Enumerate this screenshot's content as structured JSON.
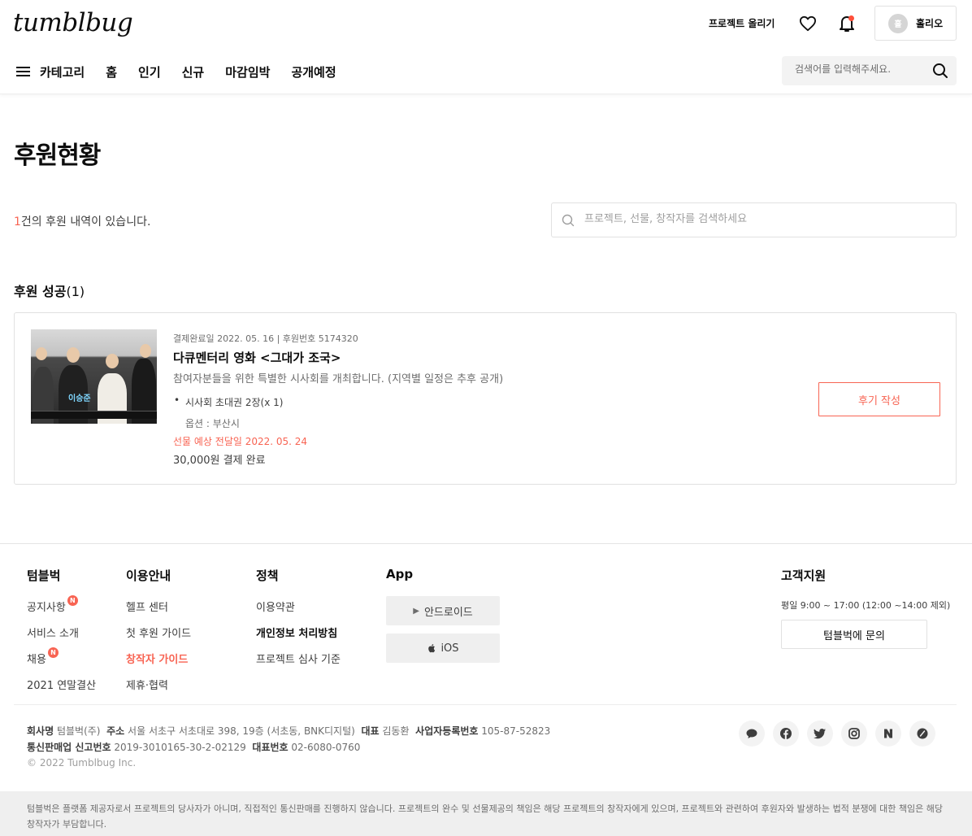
{
  "header": {
    "logo": "tumblbug",
    "upload_label": "프로젝트 올리기",
    "profile_avatar": "홀",
    "profile_name": "홀리오",
    "nav": {
      "category": "카테고리",
      "items": [
        "홈",
        "인기",
        "신규",
        "마감임박",
        "공개예정"
      ]
    },
    "search_placeholder": "검색어를 입력해주세요."
  },
  "main": {
    "title": "후원현황",
    "count_number": "1",
    "count_suffix": "건의 후원 내역이 있습니다.",
    "search_placeholder": "프로젝트, 선물, 창작자를 검색하세요",
    "section_title": "후원 성공",
    "section_count": "(1)",
    "pledge": {
      "thumb_name": "이승준",
      "meta": "결제완료일 2022. 05. 16 | 후원번호 5174320",
      "title": "다큐멘터리 영화 <그대가 조국>",
      "description": "참여자분들을 위한 특별한 시사회를 개최합니다. (지역별 일정은 추후 공개)",
      "reward": "시사회 초대권 2장(x 1)",
      "option": "옵션 : 부산시",
      "delivery": "선물 예상 전달일 2022. 05. 24",
      "payment": "30,000원 결제 완료",
      "review_button": "후기 작성"
    }
  },
  "footer": {
    "col1": {
      "title": "텀블벅",
      "links": [
        "공지사항",
        "서비스 소개",
        "채용",
        "2021 연말결산"
      ],
      "badge": "N"
    },
    "col2": {
      "title": "이용안내",
      "links": [
        "헬프 센터",
        "첫 후원 가이드",
        "창작자 가이드",
        "제휴·협력"
      ]
    },
    "col3": {
      "title": "정책",
      "links": [
        "이용약관",
        "개인정보 처리방침",
        "프로젝트 심사 기준"
      ]
    },
    "app": {
      "title": "App",
      "android": "안드로이드",
      "ios": "iOS"
    },
    "support": {
      "title": "고객지원",
      "hours": "평일 9:00 ~ 17:00 (12:00 ~14:00 제외)",
      "button": "텀블벅에 문의"
    },
    "company": {
      "name_label": "회사명",
      "name": "텀블벅(주)",
      "address_label": "주소",
      "address": "서울 서초구 서초대로 398, 19층 (서초동, BNK디지털)",
      "ceo_label": "대표",
      "ceo": "김동환",
      "biz_label": "사업자등록번호",
      "biz": "105-87-52823",
      "mail_order_label": "통신판매업 신고번호",
      "mail_order": "2019-3010165-30-2-02129",
      "phone_label": "대표번호",
      "phone": "02-6080-0760"
    },
    "copyright": "© 2022 Tumblbug Inc.",
    "social_icons": [
      "chat-icon",
      "facebook-icon",
      "twitter-icon",
      "instagram-icon",
      "naver-icon",
      "blog-icon"
    ],
    "disclaimer": "텀블벅은 플랫폼 제공자로서 프로젝트의 당사자가 아니며, 직접적인 통신판매를 진행하지 않습니다. 프로젝트의 완수 및 선물제공의 책임은 해당 프로젝트의 창작자에게 있으며, 프로젝트와 관련하여 후원자와 발생하는 법적 분쟁에 대한 책임은 해당 창작자가 부담합니다."
  },
  "colors": {
    "accent": "#f86453",
    "text": "#0d0d0d",
    "muted": "#6d6d6d"
  }
}
